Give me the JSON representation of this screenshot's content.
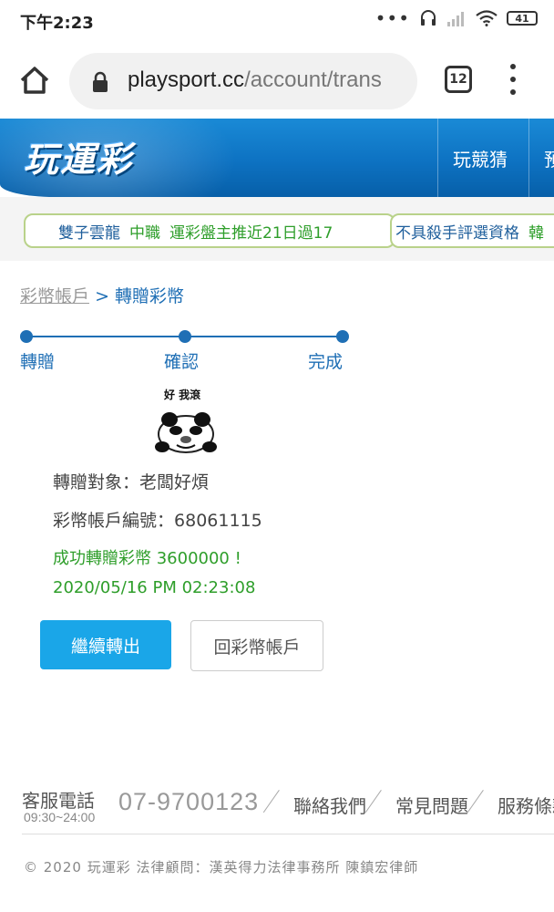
{
  "status_bar": {
    "time": "下午2:23",
    "battery": "41"
  },
  "browser": {
    "url_host": "playsport.cc",
    "url_path": "/account/trans",
    "tab_count": "12"
  },
  "site": {
    "logo": "玩運彩",
    "nav": [
      "玩競猜",
      "預"
    ]
  },
  "ticker": {
    "item1": {
      "name": "雙子雲龍",
      "league": "中職",
      "text": "運彩盤主推近21日過17"
    },
    "item2": {
      "text": "不具殺手評選資格",
      "tail": "韓"
    }
  },
  "breadcrumb": {
    "parent": "彩幣帳戶",
    "separator": ">",
    "current": "轉贈彩幣"
  },
  "steps": [
    "轉贈",
    "確認",
    "完成"
  ],
  "avatar": {
    "caption": "好 我滾"
  },
  "result": {
    "recipient_label": "轉贈對象：",
    "recipient": "老闆好煩",
    "account_label": "彩幣帳戶編號：",
    "account": "68061115",
    "success": "成功轉贈彩幣 3600000 !",
    "timestamp": "2020/05/16 PM 02:23:08"
  },
  "buttons": {
    "continue": "繼續轉出",
    "back": "回彩幣帳戶"
  },
  "footer": {
    "cs_label": "客服電話",
    "cs_hours": "09:30~24:00",
    "phone": "07-9700123",
    "links": [
      "聯絡我們",
      "常見問題",
      "服務條款"
    ],
    "copyright": "© 2020 玩運彩 法律顧問：漢英得力法律事務所 陳鎮宏律師"
  },
  "colors": {
    "primary": "#1aa6e8",
    "accent": "#1f6fb5",
    "success": "#2e9e2a",
    "header": "#0d72c2"
  }
}
